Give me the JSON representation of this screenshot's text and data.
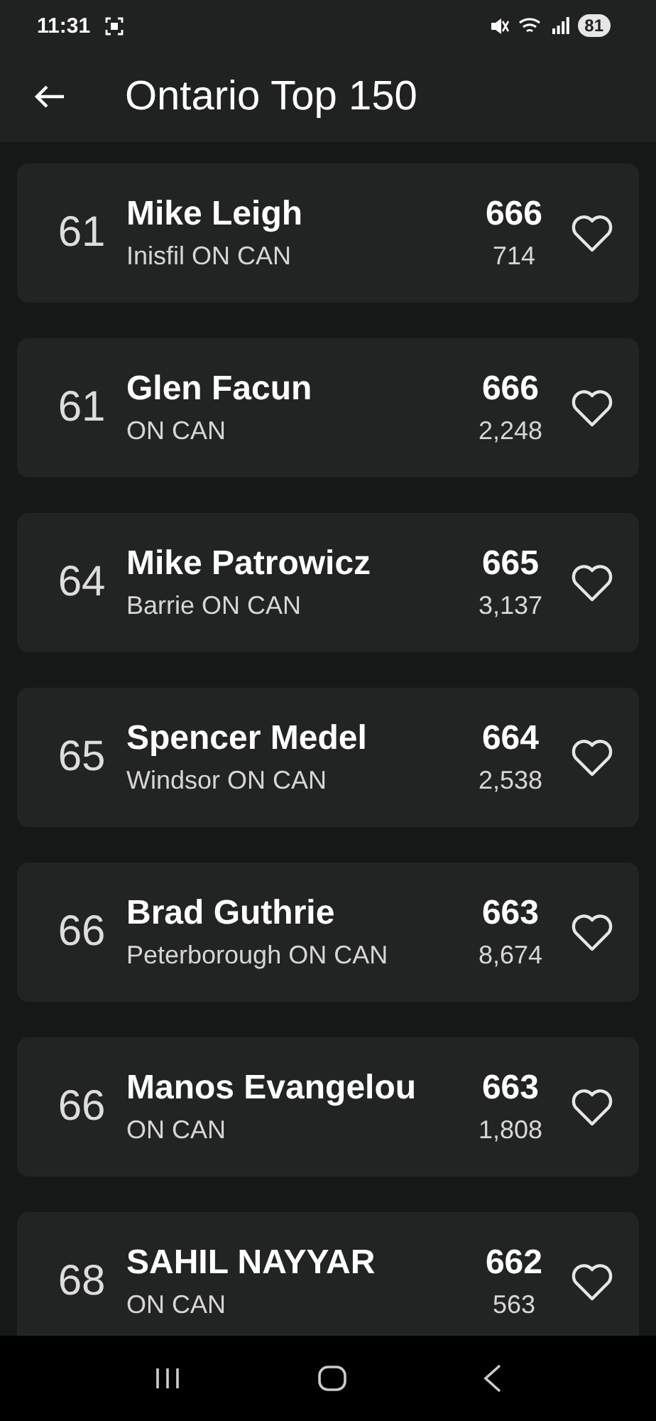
{
  "status_bar": {
    "time": "11:31",
    "battery": "81"
  },
  "app_bar": {
    "title": "Ontario Top 150"
  },
  "players": [
    {
      "rank": "61",
      "name": "Mike Leigh",
      "location": "Inisfil ON CAN",
      "score": "666",
      "count": "714"
    },
    {
      "rank": "61",
      "name": "Glen Facun",
      "location": "ON CAN",
      "score": "666",
      "count": "2,248"
    },
    {
      "rank": "64",
      "name": "Mike Patrowicz",
      "location": "Barrie ON CAN",
      "score": "665",
      "count": "3,137"
    },
    {
      "rank": "65",
      "name": "Spencer Medel",
      "location": "Windsor ON CAN",
      "score": "664",
      "count": "2,538"
    },
    {
      "rank": "66",
      "name": "Brad Guthrie",
      "location": "Peterborough ON CAN",
      "score": "663",
      "count": "8,674"
    },
    {
      "rank": "66",
      "name": "Manos Evangelou",
      "location": "ON CAN",
      "score": "663",
      "count": "1,808"
    },
    {
      "rank": "68",
      "name": "SAHIL NAYYAR",
      "location": "ON CAN",
      "score": "662",
      "count": "563"
    }
  ]
}
